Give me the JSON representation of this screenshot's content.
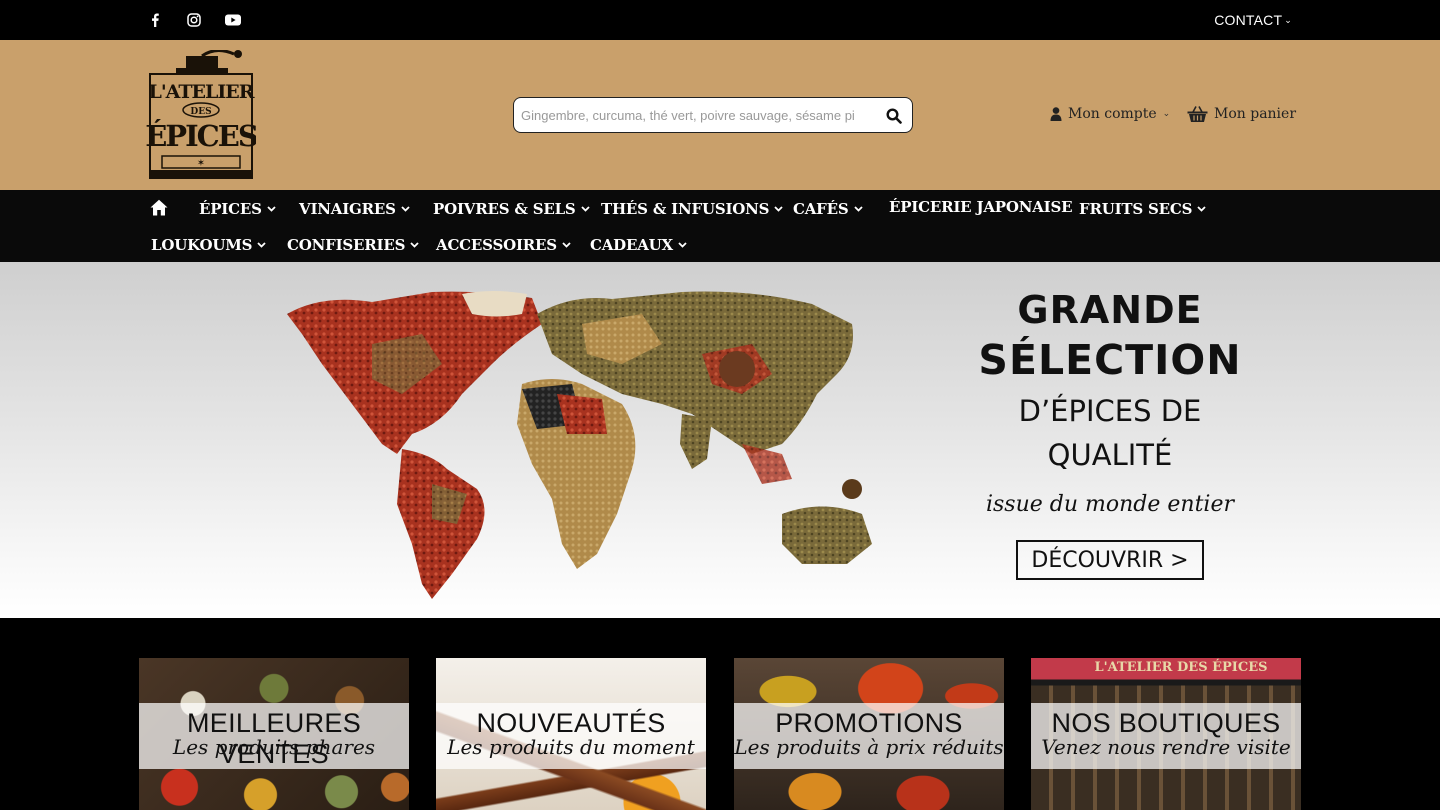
{
  "topbar": {
    "socials": [
      "facebook-icon",
      "instagram-icon",
      "youtube-icon"
    ],
    "contact_label": "CONTACT"
  },
  "header": {
    "logo_lines": [
      "L'ATELIER",
      "DES",
      "ÉPICES"
    ],
    "search_placeholder": "Gingembre, curcuma, thé vert, poivre sauvage, sésame pi",
    "account_label": "Mon compte",
    "cart_label": "Mon panier",
    "bg_color": "#c9a06b"
  },
  "nav": {
    "row1": [
      {
        "label": "ÉPICES",
        "dropdown": true
      },
      {
        "label": "VINAIGRES",
        "dropdown": true
      },
      {
        "label": "POIVRES & SELS",
        "dropdown": true
      },
      {
        "label": "THÉS & INFUSIONS",
        "dropdown": true
      },
      {
        "label": "CAFÉS",
        "dropdown": true
      },
      {
        "label": "ÉPICERIE JAPONAISE",
        "dropdown": false
      },
      {
        "label": "FRUITS SECS",
        "dropdown": true
      }
    ],
    "row2": [
      {
        "label": "LOUKOUMS",
        "dropdown": true
      },
      {
        "label": "CONFISERIES",
        "dropdown": true
      },
      {
        "label": "ACCESSOIRES",
        "dropdown": true
      },
      {
        "label": "CADEAUX",
        "dropdown": true
      }
    ]
  },
  "banner": {
    "line1": "GRANDE",
    "line2": "SÉLECTION",
    "line3": "D’ÉPICES DE",
    "line4": "QUALITÉ",
    "line5": "issue du monde entier",
    "cta_label": "DÉCOUVRIR >"
  },
  "tiles": [
    {
      "title": "MEILLEURES VENTES",
      "subtitle": "Les produits phares"
    },
    {
      "title": "NOUVEAUTÉS",
      "subtitle": "Les produits du moment"
    },
    {
      "title": "PROMOTIONS",
      "subtitle": "Les produits à prix réduits"
    },
    {
      "title": "NOS BOUTIQUES",
      "subtitle": "Venez nous rendre visite",
      "sign_text": "L'ATELIER DES ÉPICES"
    }
  ]
}
